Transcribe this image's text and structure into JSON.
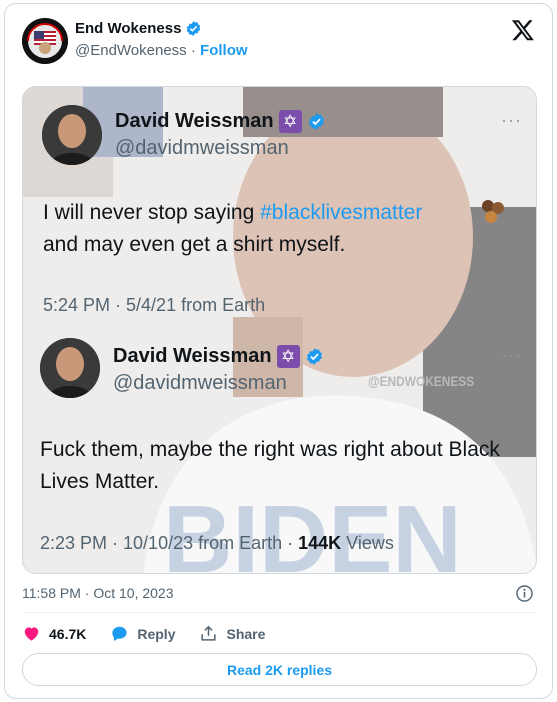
{
  "author": {
    "name": "End Wokeness",
    "handle": "@EndWokeness",
    "separator": "·",
    "follow_label": "Follow",
    "verified_color": "#1d9bf0"
  },
  "platform_icon": "x-logo-icon",
  "embedded_screenshot": {
    "quoted_post": {
      "name": "David Weissman",
      "handle": "@davidmweissman",
      "text_before_hashtag": "I will never stop saying ",
      "hashtag": "#blacklivesmatter",
      "text_after_hashtag": "and may even get a shirt myself.",
      "meta": "5:24 PM · 5/4/21 from Earth",
      "menu": "···"
    },
    "reply_post": {
      "name": "David Weissman",
      "handle": "@davidmweissman",
      "text": "Fuck them, maybe the right was right about Black Lives Matter.",
      "meta_prefix": "2:23 PM · 10/10/23 from Earth · ",
      "views_count": "144K",
      "views_label": " Views",
      "menu": "···"
    },
    "watermark": "@ENDWOKENESS",
    "shirt_text": "BIDEN"
  },
  "footer": {
    "timestamp": "11:58 PM · Oct 10, 2023",
    "likes": "46.7K",
    "reply_label": "Reply",
    "share_label": "Share",
    "read_replies": "Read 2K replies"
  },
  "colors": {
    "accent": "#1d9bf0",
    "like": "#f91880",
    "text": "#0f1419",
    "muted": "#536471",
    "border": "#cfd9de"
  }
}
